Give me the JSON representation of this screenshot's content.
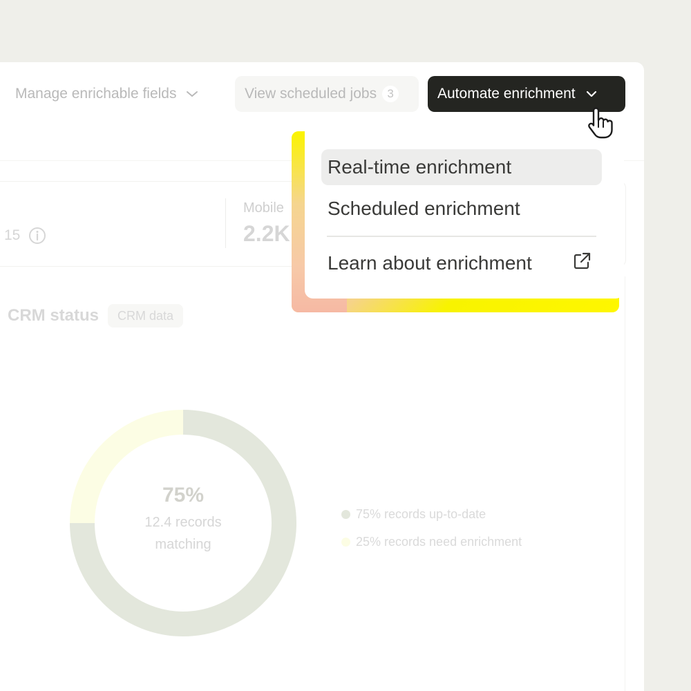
{
  "toolbar": {
    "manage_label": "Manage enrichable fields",
    "view_jobs_label": "View scheduled jobs",
    "view_jobs_count": "3",
    "automate_label": "Automate enrichment"
  },
  "stats": {
    "left_value": "15",
    "mobile_label": "Mobile",
    "mobile_value": "2.2K"
  },
  "crm": {
    "title": "CRM status",
    "badge": "CRM data"
  },
  "chart_data": {
    "type": "pie",
    "variant": "donut",
    "center_value": "75%",
    "center_label_line1": "12.4 records",
    "center_label_line2": "matching",
    "slices": [
      {
        "label": "75% records up-to-date",
        "value": 75,
        "color": "#e3e7dc"
      },
      {
        "label": "25% records need enrichment",
        "value": 25,
        "color": "#fcfde4"
      }
    ],
    "legend_placement": "right"
  },
  "menu": {
    "items": [
      {
        "label": "Real-time enrichment"
      },
      {
        "label": "Scheduled enrichment"
      },
      {
        "label": "Learn about enrichment"
      }
    ]
  },
  "colors": {
    "primary_button": "#242521",
    "highlight": "#f8f200"
  }
}
